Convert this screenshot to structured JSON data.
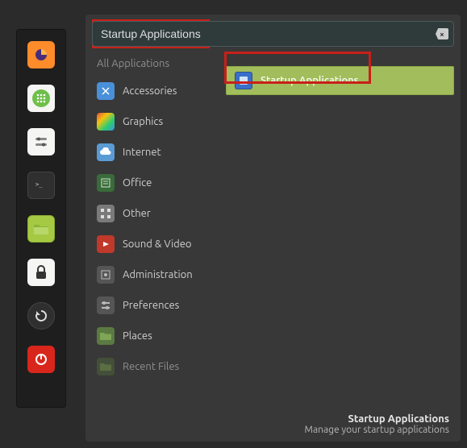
{
  "launcher": {
    "items": [
      {
        "name": "firefox-icon"
      },
      {
        "name": "apps-icon"
      },
      {
        "name": "settings-icon"
      },
      {
        "name": "terminal-icon"
      },
      {
        "name": "files-icon"
      },
      {
        "name": "lock-icon"
      },
      {
        "name": "update-icon"
      },
      {
        "name": "power-icon"
      }
    ]
  },
  "search": {
    "value": "Startup Applications"
  },
  "categories": [
    {
      "label": "All Applications",
      "icon": "all-apps-icon",
      "dim": true
    },
    {
      "label": "Accessories",
      "icon": "accessories-icon"
    },
    {
      "label": "Graphics",
      "icon": "graphics-icon"
    },
    {
      "label": "Internet",
      "icon": "internet-icon"
    },
    {
      "label": "Office",
      "icon": "office-icon"
    },
    {
      "label": "Other",
      "icon": "other-icon"
    },
    {
      "label": "Sound & Video",
      "icon": "sound-video-icon"
    },
    {
      "label": "Administration",
      "icon": "administration-icon"
    },
    {
      "label": "Preferences",
      "icon": "preferences-icon"
    },
    {
      "label": "Places",
      "icon": "places-icon"
    },
    {
      "label": "Recent Files",
      "icon": "recent-files-icon"
    }
  ],
  "results": [
    {
      "label": "Startup Applications",
      "icon": "startup-apps-icon"
    }
  ],
  "footer": {
    "title": "Startup Applications",
    "desc": "Manage your startup applications"
  }
}
